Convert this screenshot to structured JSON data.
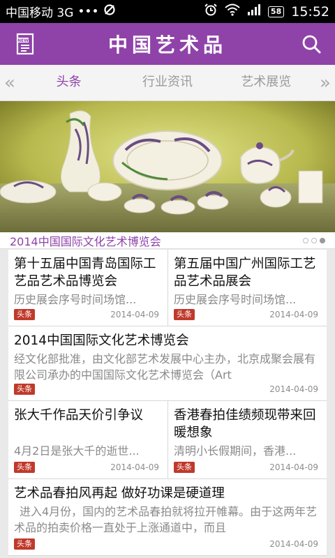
{
  "status_bar": {
    "carrier": "中国移动 3G",
    "battery": "58",
    "time": "15:52"
  },
  "header": {
    "title": "中国艺术品"
  },
  "tabs": [
    {
      "label": "头条"
    },
    {
      "label": "行业资讯"
    },
    {
      "label": "艺术展览"
    }
  ],
  "banner": {
    "caption": "2014中国国际文化艺术博览会"
  },
  "news": [
    {
      "title": "第十五届中国青岛国际工艺品艺术品博览会",
      "summary": "历史展会序号时间场馆...",
      "tag": "头条",
      "date": "2014-04-09"
    },
    {
      "title": "第五届中国广州国际工艺品艺术品展会",
      "summary": "历史展会序号时间场馆...",
      "tag": "头条",
      "date": "2014-04-09"
    },
    {
      "title": "2014中国国际文化艺术博览会",
      "summary": "经文化部批准，由文化部艺术发展中心主办，北京成聚会展有限公司承办的中国国际文化艺术博览会（Art",
      "tag": "头条",
      "date": "2014-04-09"
    },
    {
      "title": "张大千作品天价引争议",
      "summary": "4月2日是张大千的逝世...",
      "tag": "头条",
      "date": "2014-04-09"
    },
    {
      "title": "香港春拍佳绩频现带来回暖想象",
      "summary": "清明小长假期间，香港...",
      "tag": "头条",
      "date": "2014-04-09"
    },
    {
      "title": "艺术品春拍风再起 做好功课是硬道理",
      "summary": "进入4月份，国内的艺术品春拍就将拉开帷幕。由于这两年艺术品的拍卖价格一直处于上涨通道中，而且",
      "tag": "头条",
      "date": "2014-04-09"
    }
  ],
  "colors": {
    "accent": "#8f43a9",
    "tag": "#c0392b"
  }
}
